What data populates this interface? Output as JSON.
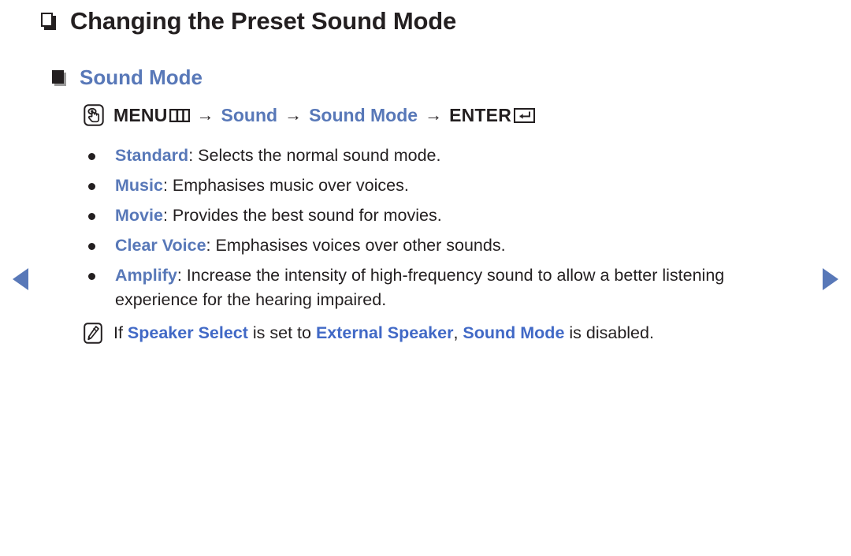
{
  "colors": {
    "accent_blue": "#5878b8",
    "note_blue": "#4169c6",
    "text_dark": "#231f20",
    "background": "#ffffff"
  },
  "nav": {
    "prev_label": "◀",
    "next_label": "▶",
    "prev_icon": "triangle-left-icon",
    "next_icon": "triangle-right-icon"
  },
  "header": {
    "title": "Changing the Preset Sound Mode",
    "bullet_icon": "outlined-box-icon"
  },
  "section": {
    "title": "Sound Mode",
    "bullet_icon": "filled-square-icon"
  },
  "menu_path": {
    "touch_icon": "hand-press-icon",
    "menu_label": "MENU",
    "menu_glyph_icon": "menu-bars-icon",
    "arrow": "→",
    "step_sound": "Sound",
    "step_sound_mode": "Sound Mode",
    "enter_label": "ENTER",
    "enter_glyph_icon": "enter-key-icon"
  },
  "modes": [
    {
      "term": "Standard",
      "separator": ": ",
      "description": "Selects the normal sound mode."
    },
    {
      "term": "Music",
      "separator": ": ",
      "description": "Emphasises music over voices."
    },
    {
      "term": "Movie",
      "separator": ": ",
      "description": "Provides the best sound for movies."
    },
    {
      "term": "Clear Voice",
      "separator": ": ",
      "description": "Emphasises voices over other sounds."
    },
    {
      "term": "Amplify",
      "separator": ": ",
      "description": "Increase the intensity of high-frequency sound to allow a better listening experience for the hearing impaired."
    }
  ],
  "note": {
    "icon": "note-pencil-icon",
    "lead": "If ",
    "term1": "Speaker Select",
    "mid1": " is set to ",
    "term2": "External Speaker",
    "mid2": ", ",
    "term3": "Sound Mode",
    "tail": " is disabled."
  }
}
